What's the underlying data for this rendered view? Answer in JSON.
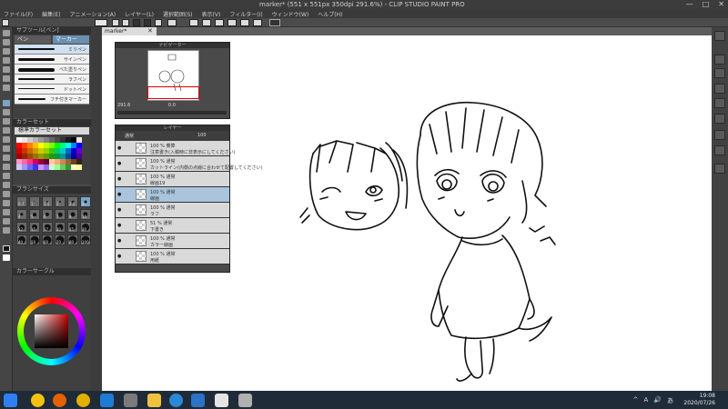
{
  "window": {
    "title": "marker* (551 x 551px 350dpi 291.6%) - CLIP STUDIO PAINT PRO",
    "controls": {
      "minimize": "—",
      "maximize": "□",
      "close": "✕"
    }
  },
  "menu": [
    "ファイル(F)",
    "編集(E)",
    "アニメーション(A)",
    "レイヤー(L)",
    "選択範囲(S)",
    "表示(V)",
    "フィルター(I)",
    "ウィンドウ(W)",
    "ヘルプ(H)"
  ],
  "subtool": {
    "header": "サブツール[ペン]",
    "tabs": [
      "ペン",
      "マーカー"
    ],
    "brushes": [
      "ミリペン",
      "サインペン",
      "べた塗りペン",
      "ラフペン",
      "ドットペン",
      "フチ付きマーカー"
    ]
  },
  "colorset": {
    "header": "カラーセット",
    "set_name": "標準カラーセット",
    "colors": [
      "#ffffff",
      "#e6e6e6",
      "#cccccc",
      "#b3b3b3",
      "#999999",
      "#808080",
      "#666666",
      "#4d4d4d",
      "#333333",
      "#1a1a1a",
      "#000000",
      "#ffe0e0",
      "#ff0000",
      "#ff4000",
      "#ff8000",
      "#ffbf00",
      "#ffff00",
      "#bfff00",
      "#80ff00",
      "#00ff00",
      "#00ff80",
      "#00ffff",
      "#0080ff",
      "#0000ff",
      "#cc0000",
      "#cc3300",
      "#cc6600",
      "#cc9900",
      "#cccc00",
      "#99cc00",
      "#33cc00",
      "#00cc66",
      "#00cccc",
      "#0066cc",
      "#0000cc",
      "#6600cc",
      "#990000",
      "#992600",
      "#994c00",
      "#997300",
      "#999900",
      "#669900",
      "#269900",
      "#00994c",
      "#009999",
      "#004c99",
      "#000099",
      "#4c0099",
      "#ff99cc",
      "#ff66aa",
      "#ff3388",
      "#cc0066",
      "#990044",
      "#660033",
      "#ffccaa",
      "#ffaa77",
      "#cc8855",
      "#996633",
      "#664422",
      "#332211",
      "#ccccff",
      "#9999ff",
      "#6666ff",
      "#3333ff",
      "#cc99ff",
      "#9966ff",
      "#ccffcc",
      "#99ff99",
      "#66cc66",
      "#339933",
      "#ffffcc",
      "#ffff99"
    ]
  },
  "brushsize": {
    "header": "ブラシサイズ",
    "sizes": [
      "0.7",
      "1",
      "1.5",
      "2",
      "2.5",
      "3",
      "4",
      "5",
      "6",
      "7",
      "8",
      "10",
      "12",
      "15",
      "17",
      "20",
      "25",
      "30",
      "40",
      "50",
      "60",
      "70",
      "80",
      "100"
    ],
    "selected_index": 5
  },
  "colorwheel": {
    "header": "カラーサークル"
  },
  "document": {
    "tab": "marker*",
    "close": "✕"
  },
  "navigator": {
    "header": "ナビゲーター",
    "zoom": "291.6",
    "angle": "0.0"
  },
  "layers": {
    "header": "レイヤー",
    "blend_mode": "通常",
    "opacity": "100",
    "items": [
      {
        "line1": "100 % 乗算",
        "line2": "注意書き(入稿時に非表示にしてください)",
        "selected": false
      },
      {
        "line1": "100 % 通常",
        "line2": "カットライン(内側の点線に合わせて配置してください)",
        "selected": false
      },
      {
        "line1": "100 % 通常",
        "line2": "線画19",
        "selected": false
      },
      {
        "line1": "100 % 通常",
        "line2": "線画",
        "selected": true
      },
      {
        "line1": "100 % 通常",
        "line2": "ラフ",
        "selected": false
      },
      {
        "line1": "51 % 通常",
        "line2": "下書き",
        "selected": false
      },
      {
        "line1": "100 % 通常",
        "line2": "カラー線画",
        "selected": false
      },
      {
        "line1": "100 % 通常",
        "line2": "用紙",
        "selected": false
      }
    ]
  },
  "taskbar": {
    "time": "19:08",
    "date": "2020/07/26",
    "tray": [
      "^",
      "A",
      "🔊",
      "あ"
    ]
  }
}
